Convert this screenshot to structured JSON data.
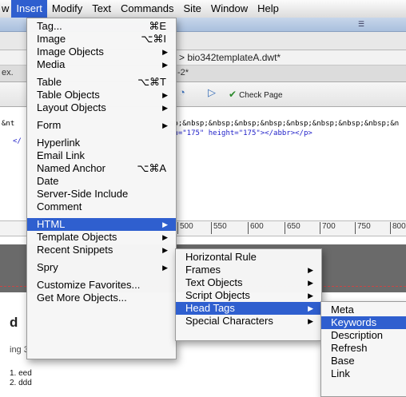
{
  "menubar": {
    "partial_first": "w",
    "items": [
      "Insert",
      "Modify",
      "Text",
      "Commands",
      "Site",
      "Window",
      "Help"
    ]
  },
  "background": {
    "file_path": "> bio342templateA.dwt*",
    "tab_fragment": "-2*",
    "tab_left_fragment": "ex.",
    "check_page": "Check Page",
    "code_line1": "sp;&nbsp;&nbsp;&nbsp;&nbsp;&nbsp;&nbsp;&nbsp;&nbsp;&n",
    "code_line2": "th=\"175\" height=\"175\"></abbr></p>",
    "code_left1": "&nt",
    "code_left2": "</",
    "ruler_ticks": [
      "500",
      "550",
      "600",
      "650",
      "700",
      "750",
      "800"
    ],
    "heading_fragment": "d",
    "subheading_fragment": "ing 3",
    "list": [
      "1. eed",
      "2. ddd"
    ]
  },
  "insert_menu": {
    "groups": [
      [
        {
          "label": "Tag...",
          "shortcut": "⌘E"
        },
        {
          "label": "Image",
          "shortcut": "⌥⌘I"
        },
        {
          "label": "Image Objects",
          "submenu": true
        },
        {
          "label": "Media",
          "submenu": true
        }
      ],
      [
        {
          "label": "Table",
          "shortcut": "⌥⌘T"
        },
        {
          "label": "Table Objects",
          "submenu": true
        },
        {
          "label": "Layout Objects",
          "submenu": true
        }
      ],
      [
        {
          "label": "Form",
          "submenu": true
        }
      ],
      [
        {
          "label": "Hyperlink"
        },
        {
          "label": "Email Link"
        },
        {
          "label": "Named Anchor",
          "shortcut": "⌥⌘A"
        },
        {
          "label": "Date"
        },
        {
          "label": "Server-Side Include"
        },
        {
          "label": "Comment"
        }
      ],
      [
        {
          "label": "HTML",
          "submenu": true,
          "highlighted": true
        },
        {
          "label": "Template Objects",
          "submenu": true
        },
        {
          "label": "Recent Snippets",
          "submenu": true
        }
      ],
      [
        {
          "label": "Spry",
          "submenu": true
        }
      ],
      [
        {
          "label": "Customize Favorites..."
        },
        {
          "label": "Get More Objects..."
        }
      ]
    ]
  },
  "html_menu": {
    "groups": [
      [
        {
          "label": "Horizontal Rule"
        },
        {
          "label": "Frames",
          "submenu": true
        },
        {
          "label": "Text Objects",
          "submenu": true
        },
        {
          "label": "Script Objects",
          "submenu": true
        },
        {
          "label": "Head Tags",
          "submenu": true,
          "highlighted": true
        },
        {
          "label": "Special Characters",
          "submenu": true
        }
      ]
    ]
  },
  "head_tags_menu": {
    "groups": [
      [
        {
          "label": "Meta"
        },
        {
          "label": "Keywords",
          "highlighted": true
        },
        {
          "label": "Description"
        },
        {
          "label": "Refresh"
        },
        {
          "label": "Base"
        },
        {
          "label": "Link"
        }
      ]
    ]
  },
  "colors": {
    "highlight": "#2f5fcf",
    "menu_bg": "#f6f6f6"
  }
}
